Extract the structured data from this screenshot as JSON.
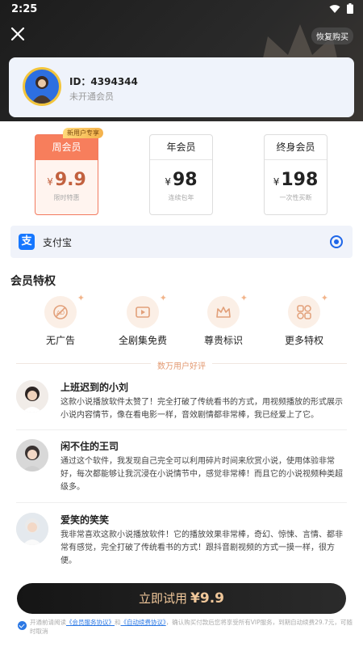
{
  "status": {
    "time": "2:25"
  },
  "header": {
    "restore_label": "恢复购买"
  },
  "user": {
    "id_text": "ID：4394344",
    "vip_status": "未开通会员"
  },
  "plans": [
    {
      "title": "周会员",
      "yen": "¥",
      "price": "9.9",
      "sub": "限时特惠",
      "badge": "新用户专享",
      "selected": true
    },
    {
      "title": "年会员",
      "yen": "¥",
      "price": "98",
      "sub": "连续包年"
    },
    {
      "title": "终身会员",
      "yen": "¥",
      "price": "198",
      "sub": "一次性买断"
    }
  ],
  "payment": {
    "method": "支付宝",
    "icon": "alipay-icon",
    "color": "#1677ff"
  },
  "privileges": {
    "title": "会员特权",
    "items": [
      {
        "label": "无广告",
        "icon": "no-ads-icon"
      },
      {
        "label": "全剧集免费",
        "icon": "play-video-icon"
      },
      {
        "label": "尊贵标识",
        "icon": "crown-icon"
      },
      {
        "label": "更多特权",
        "icon": "grid-icon"
      }
    ]
  },
  "reviews": {
    "title": "数万用户好评",
    "items": [
      {
        "name": "上班迟到的小刘",
        "text": "这款小说播放软件太赞了！完全打破了传统看书的方式，用视频播放的形式展示小说内容情节，像在看电影一样，音效剧情都非常棒，我已经爱上了它。"
      },
      {
        "name": "闲不住的王司",
        "text": "通过这个软件，我发现自己完全可以利用碎片时间来欣赏小说，使用体验非常好，每次都能够让我沉浸在小说情节中，感觉非常棒！而且它的小说视频种类超级多。"
      },
      {
        "name": "爱笑的笑笑",
        "text": "我非常喜欢这款小说播放软件！它的播放效果非常棒，奇幻、惊悚、言情、都非常有感觉，完全打破了传统看书的方式！跟抖音剧视频的方式一摸一样，很方便。"
      }
    ]
  },
  "cta": {
    "label": "立即试用",
    "price": "¥9.9"
  },
  "agreement": {
    "prefix": "开通前请阅读",
    "link1": "《会员服务协议》",
    "and": "和",
    "link2": "《自动续费协议》",
    "suffix": "，确认购买付款后您将享受所有VIP服务，到期自动续费29.7元，可随时取消"
  },
  "colors": {
    "accent": "#f77e5c",
    "gold": "#f0c79a",
    "blue": "#1e66e8"
  }
}
